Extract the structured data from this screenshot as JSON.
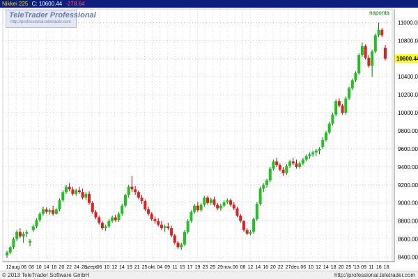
{
  "header": {
    "instrument": "Nikkei 225",
    "close_label": "C: 10600.44",
    "change": "-278.64"
  },
  "logo": {
    "title": "TeleTrader Professional",
    "url": "http://professional.teletrader.com"
  },
  "footer": {
    "copyright": "© 2013 TeleTrader Software GmbH",
    "url": "http://professional.teletrader.com"
  },
  "colors": {
    "up": "#1fc21f",
    "down": "#e61e1e",
    "header_bg": "#0d1f7a",
    "price_marker": "#ffff00"
  },
  "chart_data": {
    "type": "candlestick",
    "title": "",
    "period_label": "naponta",
    "ylim": [
      8350,
      11150
    ],
    "y_ticks": [
      8400,
      8600,
      8800,
      9000,
      9200,
      9400,
      9600,
      9800,
      10000,
      10200,
      10400,
      10600,
      10800,
      11000
    ],
    "y_tick_labels": [
      "8400.00",
      "8600.00",
      "8800.00",
      "9000.00",
      "9200.00",
      "9400.00",
      "9600.00",
      "9800.00",
      "10000.00",
      "10200.00",
      "10400.00",
      "10600.00",
      "10800.00",
      "11000.00"
    ],
    "last_price_label": "10600.44",
    "last_price": 10600.44,
    "x_tick_labels": [
      "12",
      "aug.",
      "06",
      "08",
      "10",
      "14",
      "16",
      "20",
      "22",
      "24",
      "28",
      "szept.",
      "06",
      "10",
      "12",
      "14",
      "19",
      "21",
      "25",
      "okt.",
      "04",
      "09",
      "11",
      "15",
      "17",
      "19",
      "23",
      "25",
      "29",
      "nov.",
      "06",
      "08",
      "12",
      "14",
      "16",
      "20",
      "22",
      "27",
      "dec.",
      "06",
      "10",
      "12",
      "14",
      "18",
      "20",
      "25",
      "'13",
      "09",
      "11",
      "16",
      "18"
    ],
    "grid": true,
    "candles": [
      {
        "o": 8420,
        "h": 8470,
        "l": 8390,
        "c": 8450
      },
      {
        "o": 8450,
        "h": 8520,
        "l": 8430,
        "c": 8510
      },
      {
        "o": 8510,
        "h": 8620,
        "l": 8490,
        "c": 8600
      },
      {
        "o": 8600,
        "h": 8700,
        "l": 8580,
        "c": 8680
      },
      {
        "o": 8680,
        "h": 8720,
        "l": 8610,
        "c": 8630
      },
      {
        "o": 8630,
        "h": 8680,
        "l": 8560,
        "c": 8660
      },
      {
        "o": 8660,
        "h": 8700,
        "l": 8620,
        "c": 8680
      },
      {
        "o": 8560,
        "h": 8600,
        "l": 8520,
        "c": 8580
      },
      {
        "o": 8700,
        "h": 8760,
        "l": 8680,
        "c": 8740
      },
      {
        "o": 8740,
        "h": 8830,
        "l": 8720,
        "c": 8810
      },
      {
        "o": 8810,
        "h": 8900,
        "l": 8790,
        "c": 8880
      },
      {
        "o": 8880,
        "h": 8960,
        "l": 8860,
        "c": 8930
      },
      {
        "o": 8930,
        "h": 8950,
        "l": 8880,
        "c": 8900
      },
      {
        "o": 8900,
        "h": 8940,
        "l": 8870,
        "c": 8920
      },
      {
        "o": 8920,
        "h": 8970,
        "l": 8860,
        "c": 8880
      },
      {
        "o": 8880,
        "h": 8940,
        "l": 8870,
        "c": 8930
      },
      {
        "o": 8930,
        "h": 9050,
        "l": 8910,
        "c": 9030
      },
      {
        "o": 9030,
        "h": 9140,
        "l": 9010,
        "c": 9120
      },
      {
        "o": 9120,
        "h": 9200,
        "l": 9100,
        "c": 9180
      },
      {
        "o": 9180,
        "h": 9220,
        "l": 9130,
        "c": 9150
      },
      {
        "o": 9150,
        "h": 9180,
        "l": 9080,
        "c": 9100
      },
      {
        "o": 9100,
        "h": 9160,
        "l": 9080,
        "c": 9140
      },
      {
        "o": 9140,
        "h": 9180,
        "l": 9100,
        "c": 9120
      },
      {
        "o": 9120,
        "h": 9160,
        "l": 9040,
        "c": 9060
      },
      {
        "o": 9060,
        "h": 9120,
        "l": 9030,
        "c": 9100
      },
      {
        "o": 9100,
        "h": 9130,
        "l": 8980,
        "c": 9000
      },
      {
        "o": 9000,
        "h": 9020,
        "l": 8880,
        "c": 8900
      },
      {
        "o": 8900,
        "h": 8920,
        "l": 8820,
        "c": 8840
      },
      {
        "o": 8840,
        "h": 8860,
        "l": 8760,
        "c": 8780
      },
      {
        "o": 8780,
        "h": 8800,
        "l": 8700,
        "c": 8720
      },
      {
        "o": 8720,
        "h": 8760,
        "l": 8690,
        "c": 8740
      },
      {
        "o": 8740,
        "h": 8820,
        "l": 8720,
        "c": 8800
      },
      {
        "o": 8800,
        "h": 8860,
        "l": 8780,
        "c": 8840
      },
      {
        "o": 8840,
        "h": 8870,
        "l": 8790,
        "c": 8810
      },
      {
        "o": 8810,
        "h": 8900,
        "l": 8790,
        "c": 8880
      },
      {
        "o": 8880,
        "h": 8990,
        "l": 8860,
        "c": 8970
      },
      {
        "o": 8970,
        "h": 9100,
        "l": 8950,
        "c": 9090
      },
      {
        "o": 9090,
        "h": 9200,
        "l": 9060,
        "c": 9180
      },
      {
        "o": 9180,
        "h": 9300,
        "l": 9120,
        "c": 9150
      },
      {
        "o": 9150,
        "h": 9190,
        "l": 9090,
        "c": 9120
      },
      {
        "o": 9120,
        "h": 9140,
        "l": 9040,
        "c": 9060
      },
      {
        "o": 9060,
        "h": 9090,
        "l": 8990,
        "c": 9020
      },
      {
        "o": 9020,
        "h": 9040,
        "l": 8910,
        "c": 8930
      },
      {
        "o": 8930,
        "h": 8960,
        "l": 8860,
        "c": 8880
      },
      {
        "o": 8880,
        "h": 8900,
        "l": 8800,
        "c": 8820
      },
      {
        "o": 8820,
        "h": 8850,
        "l": 8770,
        "c": 8800
      },
      {
        "o": 8800,
        "h": 8830,
        "l": 8740,
        "c": 8760
      },
      {
        "o": 8760,
        "h": 8800,
        "l": 8700,
        "c": 8720
      },
      {
        "o": 8720,
        "h": 8760,
        "l": 8680,
        "c": 8740
      },
      {
        "o": 8740,
        "h": 8780,
        "l": 8700,
        "c": 8720
      },
      {
        "o": 8720,
        "h": 8750,
        "l": 8620,
        "c": 8640
      },
      {
        "o": 8640,
        "h": 8660,
        "l": 8540,
        "c": 8560
      },
      {
        "o": 8560,
        "h": 8580,
        "l": 8490,
        "c": 8510
      },
      {
        "o": 8510,
        "h": 8560,
        "l": 8480,
        "c": 8540
      },
      {
        "o": 8540,
        "h": 8700,
        "l": 8520,
        "c": 8680
      },
      {
        "o": 8680,
        "h": 8820,
        "l": 8660,
        "c": 8800
      },
      {
        "o": 8800,
        "h": 8920,
        "l": 8780,
        "c": 8900
      },
      {
        "o": 8900,
        "h": 8990,
        "l": 8880,
        "c": 8970
      },
      {
        "o": 8970,
        "h": 9010,
        "l": 8900,
        "c": 8920
      },
      {
        "o": 8920,
        "h": 9000,
        "l": 8900,
        "c": 8980
      },
      {
        "o": 8980,
        "h": 9080,
        "l": 8960,
        "c": 9060
      },
      {
        "o": 9060,
        "h": 9080,
        "l": 8980,
        "c": 9000
      },
      {
        "o": 9000,
        "h": 9060,
        "l": 8980,
        "c": 9040
      },
      {
        "o": 9040,
        "h": 9070,
        "l": 8960,
        "c": 8980
      },
      {
        "o": 8980,
        "h": 9000,
        "l": 8920,
        "c": 8940
      },
      {
        "o": 8940,
        "h": 8990,
        "l": 8910,
        "c": 8970
      },
      {
        "o": 8970,
        "h": 9030,
        "l": 8950,
        "c": 9010
      },
      {
        "o": 9010,
        "h": 9050,
        "l": 8990,
        "c": 9030
      },
      {
        "o": 9030,
        "h": 9050,
        "l": 8960,
        "c": 8980
      },
      {
        "o": 8980,
        "h": 9010,
        "l": 8920,
        "c": 8940
      },
      {
        "o": 8940,
        "h": 8960,
        "l": 8840,
        "c": 8860
      },
      {
        "o": 8860,
        "h": 8880,
        "l": 8780,
        "c": 8800
      },
      {
        "o": 8800,
        "h": 8810,
        "l": 8680,
        "c": 8700
      },
      {
        "o": 8700,
        "h": 8720,
        "l": 8640,
        "c": 8660
      },
      {
        "o": 8660,
        "h": 8700,
        "l": 8640,
        "c": 8680
      },
      {
        "o": 8680,
        "h": 8840,
        "l": 8660,
        "c": 8820
      },
      {
        "o": 8820,
        "h": 9010,
        "l": 8800,
        "c": 8990
      },
      {
        "o": 8990,
        "h": 9180,
        "l": 8970,
        "c": 9160
      },
      {
        "o": 9160,
        "h": 9220,
        "l": 9120,
        "c": 9200
      },
      {
        "o": 9200,
        "h": 9270,
        "l": 9170,
        "c": 9250
      },
      {
        "o": 9250,
        "h": 9400,
        "l": 9230,
        "c": 9380
      },
      {
        "o": 9380,
        "h": 9480,
        "l": 9360,
        "c": 9460
      },
      {
        "o": 9460,
        "h": 9500,
        "l": 9400,
        "c": 9420
      },
      {
        "o": 9420,
        "h": 9440,
        "l": 9350,
        "c": 9370
      },
      {
        "o": 9370,
        "h": 9400,
        "l": 9300,
        "c": 9330
      },
      {
        "o": 9330,
        "h": 9430,
        "l": 9310,
        "c": 9410
      },
      {
        "o": 9410,
        "h": 9480,
        "l": 9390,
        "c": 9460
      },
      {
        "o": 9460,
        "h": 9500,
        "l": 9420,
        "c": 9440
      },
      {
        "o": 9440,
        "h": 9480,
        "l": 9380,
        "c": 9400
      },
      {
        "o": 9400,
        "h": 9460,
        "l": 9380,
        "c": 9440
      },
      {
        "o": 9440,
        "h": 9500,
        "l": 9420,
        "c": 9480
      },
      {
        "o": 9480,
        "h": 9540,
        "l": 9460,
        "c": 9520
      },
      {
        "o": 9520,
        "h": 9560,
        "l": 9490,
        "c": 9540
      },
      {
        "o": 9540,
        "h": 9580,
        "l": 9510,
        "c": 9560
      },
      {
        "o": 9560,
        "h": 9600,
        "l": 9520,
        "c": 9580
      },
      {
        "o": 9580,
        "h": 9620,
        "l": 9540,
        "c": 9600
      },
      {
        "o": 9620,
        "h": 9730,
        "l": 9600,
        "c": 9700
      },
      {
        "o": 9700,
        "h": 9800,
        "l": 9680,
        "c": 9780
      },
      {
        "o": 9780,
        "h": 9900,
        "l": 9760,
        "c": 9880
      },
      {
        "o": 9880,
        "h": 10000,
        "l": 9860,
        "c": 9980
      },
      {
        "o": 9980,
        "h": 10150,
        "l": 9960,
        "c": 10130
      },
      {
        "o": 10130,
        "h": 10160,
        "l": 10060,
        "c": 10080
      },
      {
        "o": 10080,
        "h": 10100,
        "l": 9980,
        "c": 10000
      },
      {
        "o": 10000,
        "h": 10180,
        "l": 9980,
        "c": 10160
      },
      {
        "o": 10160,
        "h": 10290,
        "l": 10140,
        "c": 10270
      },
      {
        "o": 10270,
        "h": 10380,
        "l": 10250,
        "c": 10360
      },
      {
        "o": 10360,
        "h": 10460,
        "l": 10340,
        "c": 10440
      },
      {
        "o": 10440,
        "h": 10660,
        "l": 10420,
        "c": 10640
      },
      {
        "o": 10640,
        "h": 10780,
        "l": 10620,
        "c": 10740
      },
      {
        "o": 10740,
        "h": 10760,
        "l": 10590,
        "c": 10610
      },
      {
        "o": 10610,
        "h": 10640,
        "l": 10500,
        "c": 10520
      },
      {
        "o": 10520,
        "h": 10700,
        "l": 10400,
        "c": 10680
      },
      {
        "o": 10680,
        "h": 10880,
        "l": 10660,
        "c": 10860
      },
      {
        "o": 10860,
        "h": 11000,
        "l": 10840,
        "c": 10920
      },
      {
        "o": 10920,
        "h": 10940,
        "l": 10840,
        "c": 10860
      },
      {
        "o": 10720,
        "h": 10750,
        "l": 10580,
        "c": 10600
      }
    ]
  }
}
